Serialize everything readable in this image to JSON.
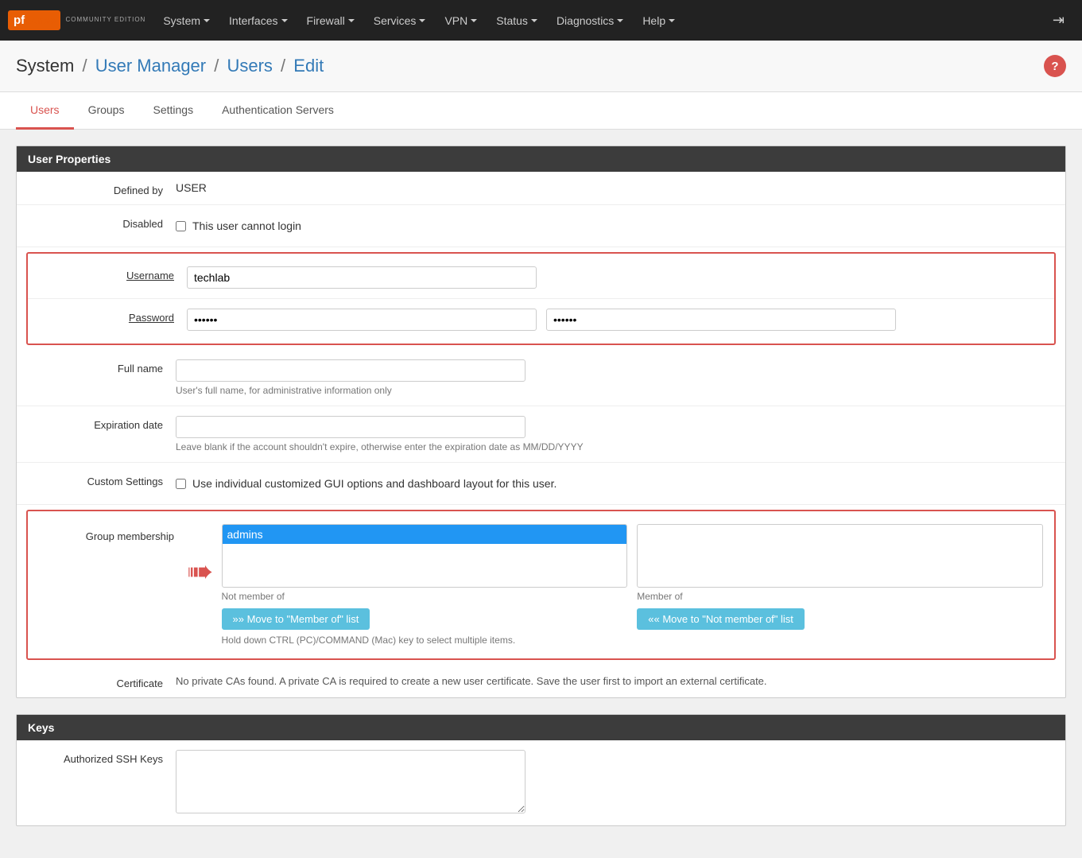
{
  "navbar": {
    "brand": {
      "logo": "pf",
      "sub": "COMMUNITY EDITION"
    },
    "items": [
      {
        "label": "System",
        "id": "system"
      },
      {
        "label": "Interfaces",
        "id": "interfaces"
      },
      {
        "label": "Firewall",
        "id": "firewall"
      },
      {
        "label": "Services",
        "id": "services"
      },
      {
        "label": "VPN",
        "id": "vpn"
      },
      {
        "label": "Status",
        "id": "status"
      },
      {
        "label": "Diagnostics",
        "id": "diagnostics"
      },
      {
        "label": "Help",
        "id": "help"
      }
    ],
    "logout_icon": "→"
  },
  "breadcrumb": {
    "parts": [
      {
        "text": "System",
        "type": "static"
      },
      {
        "text": "/",
        "type": "sep"
      },
      {
        "text": "User Manager",
        "type": "link"
      },
      {
        "text": "/",
        "type": "sep"
      },
      {
        "text": "Users",
        "type": "link"
      },
      {
        "text": "/",
        "type": "sep"
      },
      {
        "text": "Edit",
        "type": "link"
      }
    ],
    "help_label": "?"
  },
  "tabs": [
    {
      "label": "Users",
      "active": true
    },
    {
      "label": "Groups",
      "active": false
    },
    {
      "label": "Settings",
      "active": false
    },
    {
      "label": "Authentication Servers",
      "active": false
    }
  ],
  "user_properties": {
    "section_title": "User Properties",
    "fields": {
      "defined_by": {
        "label": "Defined by",
        "value": "USER"
      },
      "disabled": {
        "label": "Disabled",
        "checkbox_label": "This user cannot login"
      },
      "username": {
        "label": "Username",
        "value": "techlab",
        "placeholder": ""
      },
      "password": {
        "label": "Password",
        "value": "••••••",
        "confirm_value": "••••••"
      },
      "full_name": {
        "label": "Full name",
        "value": "",
        "placeholder": "",
        "hint": "User's full name, for administrative information only"
      },
      "expiration_date": {
        "label": "Expiration date",
        "value": "",
        "placeholder": "",
        "hint": "Leave blank if the account shouldn't expire, otherwise enter the expiration date as MM/DD/YYYY"
      },
      "custom_settings": {
        "label": "Custom Settings",
        "checkbox_label": "Use individual customized GUI options and dashboard layout for this user."
      },
      "group_membership": {
        "label": "Group membership",
        "not_member_label": "Not member of",
        "member_label": "Member of",
        "not_member_items": [
          "admins"
        ],
        "member_items": [],
        "move_to_member_btn": "Move to \"Member of\" list",
        "move_to_not_member_btn": "Move to \"Not member of\" list",
        "hint": "Hold down CTRL (PC)/COMMAND (Mac) key to select multiple items."
      },
      "certificate": {
        "label": "Certificate",
        "value": "No private CAs found. A private CA is required to create a new user certificate. Save the user first to import an external certificate."
      }
    }
  },
  "keys_section": {
    "title": "Keys",
    "authorized_ssh_keys": {
      "label": "Authorized SSH Keys",
      "value": ""
    }
  }
}
